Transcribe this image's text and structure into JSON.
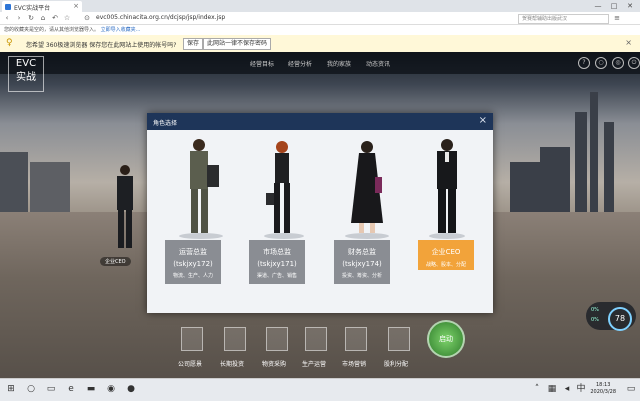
{
  "browser": {
    "tab_title": "EVC实战平台",
    "address": "evc005.chinacita.org.cn/dcjsp/jsp/index.jsp",
    "search_placeholder": "贺赛帮辅助出版武汉",
    "bookmark_notice": "您的收藏夹是空的，请从其他浏览器导入。",
    "bookmark_link": "立即导入收藏夹...",
    "password_prompt": "您希望 360极速浏览器 保存您在此网站上使用的帐号吗?",
    "save_btn": "保存",
    "never_btn": "此网站一律不保存密码"
  },
  "app": {
    "logo_top": "EVC",
    "logo_bottom": "实战",
    "nav": [
      "经营目标",
      "经营分析",
      "我的家族",
      "动态资讯"
    ],
    "ceo_label": "企业CEO",
    "modal_title": "角色选择",
    "roles": [
      {
        "name": "运营总监",
        "code": "(tskjxy172)",
        "resp": "物流、生产、人力",
        "active": false
      },
      {
        "name": "市场总监",
        "code": "(tskjxy171)",
        "resp": "渠道、广告、销售",
        "active": false
      },
      {
        "name": "财务总监",
        "code": "(tskjxy174)",
        "resp": "投资、筹资、分析",
        "active": false
      },
      {
        "name": "企业CEO",
        "code": "",
        "resp": "战略、股本、分配",
        "active": true
      }
    ],
    "tools": [
      "公司愿景",
      "长期投资",
      "物资采购",
      "生产运营",
      "市场营销",
      "股利分配"
    ],
    "big_button": "启动",
    "gauge": {
      "value": "78",
      "row1": "0%",
      "row2": "0%"
    },
    "colors": {
      "accent": "#f2a33a",
      "header": "#1e3559"
    }
  },
  "taskbar": {
    "time": "18:13",
    "date": "2020/3/28"
  }
}
